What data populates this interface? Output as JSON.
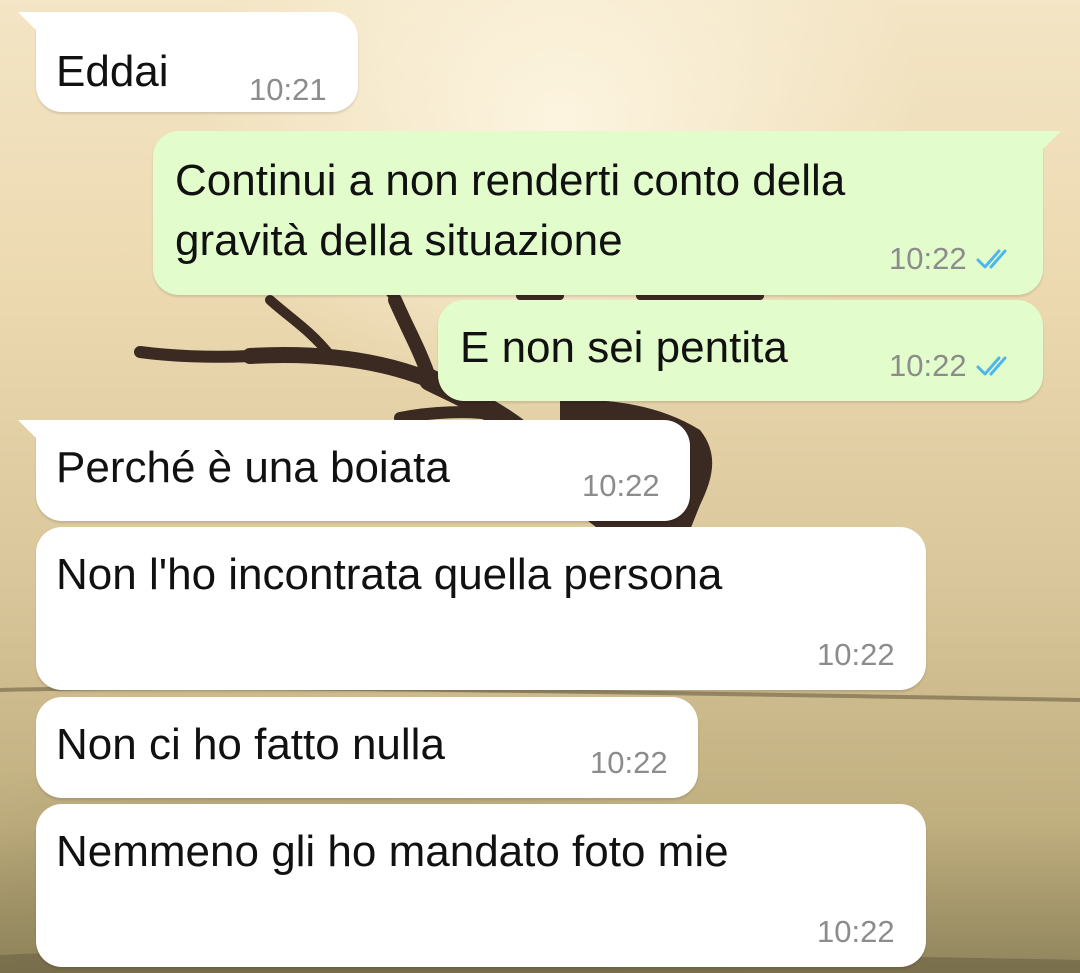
{
  "messages": [
    {
      "direction": "in",
      "text": "Eddai",
      "time": "10:21"
    },
    {
      "direction": "out",
      "text_lines": [
        "Continui a non renderti conto della",
        "gravità della situazione"
      ],
      "time": "10:22",
      "status_icon": "double-check-read-icon"
    },
    {
      "direction": "out",
      "text": "E non sei pentita",
      "time": "10:22",
      "status_icon": "double-check-read-icon"
    },
    {
      "direction": "in",
      "text": "Perché è una boiata",
      "time": "10:22"
    },
    {
      "direction": "in",
      "text": "Non l'ho incontrata quella persona",
      "time": "10:22"
    },
    {
      "direction": "in",
      "text": "Non ci ho fatto nulla",
      "time": "10:22"
    },
    {
      "direction": "in",
      "text": "Nemmeno gli ho mandato foto mie",
      "time": "10:22"
    }
  ],
  "colors": {
    "incoming_bubble": "#ffffff",
    "outgoing_bubble": "#e2fdcb",
    "read_tick": "#4fb6ec",
    "timestamp": "#8c8c8c",
    "message_text": "#111111"
  }
}
